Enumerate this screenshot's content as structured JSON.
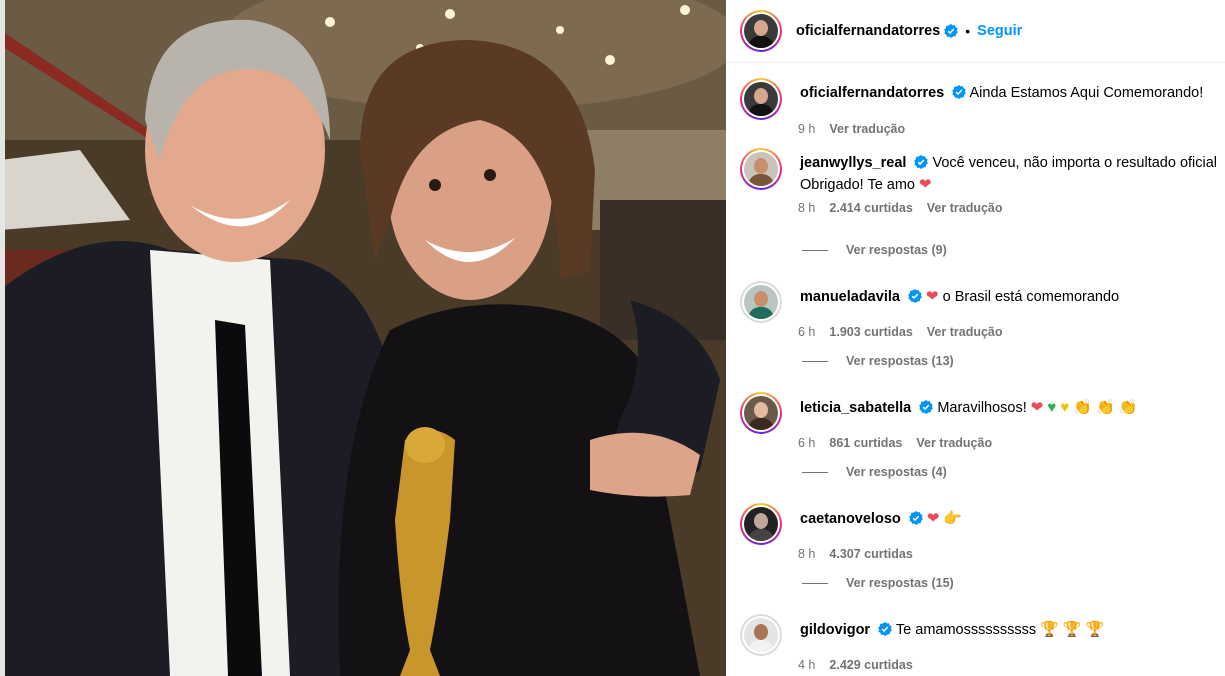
{
  "post": {
    "username": "oficialfernandatorres",
    "follow_label": "Seguir",
    "separator": "•"
  },
  "icons": {
    "verified": "verified-badge-icon",
    "avatar": "profile-avatar-icon"
  },
  "colors": {
    "link_blue": "#0095f6",
    "verified_blue": "#0095f6",
    "meta_gray": "#737373",
    "heart_red": "#ed4956"
  },
  "comments": [
    {
      "username": "oficialfernandatorres",
      "text": "Ainda Estamos Aqui Comemorando!",
      "time": "9 h",
      "likes": "",
      "translate": "Ver tradução",
      "replies": ""
    },
    {
      "username": "jeanwyllys_real",
      "text": "Você venceu, não importa o resultado oficial Obrigado! Te amo",
      "emoji": "❤",
      "time": "8 h",
      "likes": "2.414 curtidas",
      "translate": "Ver tradução",
      "replies": "Ver respostas (9)"
    },
    {
      "username": "manueladavila",
      "text_prefix_emoji": "❤",
      "text": "o Brasil está comemorando",
      "time": "6 h",
      "likes": "1.903 curtidas",
      "translate": "Ver tradução",
      "replies": "Ver respostas (13)"
    },
    {
      "username": "leticia_sabatella",
      "text": "Maravilhosos!",
      "emojis": [
        "❤",
        "♥",
        "♥",
        "👏",
        "👏",
        "👏"
      ],
      "time": "6 h",
      "likes": "861 curtidas",
      "translate": "Ver tradução",
      "replies": "Ver respostas (4)"
    },
    {
      "username": "caetanoveloso",
      "text": "",
      "emojis": [
        "❤",
        "👉"
      ],
      "time": "8 h",
      "likes": "4.307 curtidas",
      "translate": "",
      "replies": "Ver respostas (15)"
    },
    {
      "username": "gildovigor",
      "text": "Te amamossssssssss",
      "emojis": [
        "🏆",
        "🏆",
        "🏆"
      ],
      "time": "4 h",
      "likes": "2.429 curtidas",
      "translate": "",
      "replies": ""
    }
  ]
}
